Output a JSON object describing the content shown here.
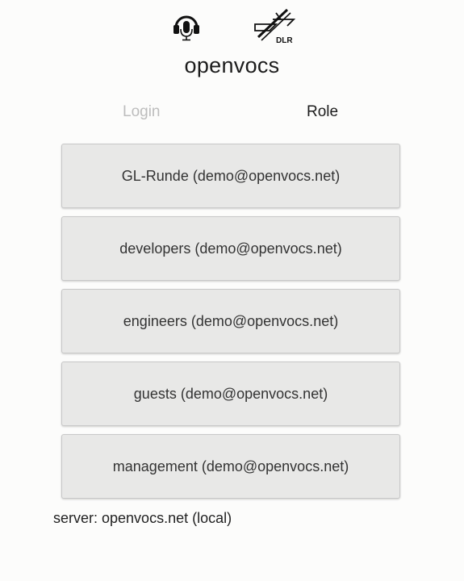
{
  "app": {
    "title": "openvocs",
    "logos": [
      "headset-microphone-icon",
      "dlr-logo"
    ]
  },
  "tabs": {
    "login": "Login",
    "role": "Role",
    "active": "Role"
  },
  "roles": [
    {
      "label": "GL-Runde (demo@openvocs.net)"
    },
    {
      "label": "developers (demo@openvocs.net)"
    },
    {
      "label": "engineers (demo@openvocs.net)"
    },
    {
      "label": "guests (demo@openvocs.net)"
    },
    {
      "label": "management (demo@openvocs.net)"
    }
  ],
  "footer": {
    "server": "server: openvocs.net (local)"
  },
  "colors": {
    "background": "#fcfcfb",
    "button": "#e8e8e7",
    "inactive_tab": "#bdbdbd",
    "text": "#222222"
  }
}
